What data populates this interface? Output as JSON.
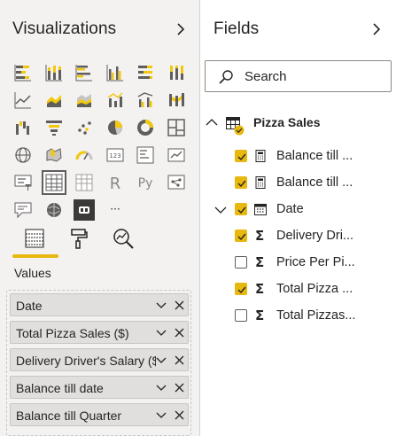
{
  "visualizations": {
    "title": "Visualizations",
    "gallery": [
      [
        "stacked-bar-chart",
        "stacked-column-chart",
        "clustered-bar-chart",
        "clustered-column-chart",
        "100-stacked-bar-chart",
        "100-stacked-column-chart"
      ],
      [
        "line-chart",
        "area-chart",
        "stacked-area-chart",
        "line-and-stacked-column-chart",
        "line-and-clustered-column-chart",
        "ribbon-chart"
      ],
      [
        "waterfall-chart",
        "funnel-chart",
        "scatter-chart",
        "pie-chart",
        "donut-chart",
        "treemap"
      ],
      [
        "map",
        "filled-map",
        "gauge",
        "card",
        "multi-row-card",
        "kpi"
      ],
      [
        "slicer",
        "table",
        "matrix",
        "r-visual",
        "python-visual",
        "key-influencers"
      ],
      [
        "qa-visual",
        "arcgis-map",
        "custom-visual",
        "more-visuals"
      ]
    ],
    "selected": "table",
    "r_letter": "R",
    "py_letters": "Py",
    "more_label": "···",
    "build_tabs": [
      "fields-tab",
      "format-tab",
      "analytics-tab"
    ],
    "active_tab": "fields-tab",
    "values_label": "Values",
    "wells": [
      {
        "label": "Date"
      },
      {
        "label": "Total Pizza Sales ($)"
      },
      {
        "label": "Delivery Driver's Salary ($)"
      },
      {
        "label": "Balance till date"
      },
      {
        "label": "Balance till Quarter"
      }
    ]
  },
  "fields": {
    "title": "Fields",
    "search_placeholder": "Search",
    "table_name": "Pizza Sales",
    "items": [
      {
        "label": "Balance till ...",
        "checked": true,
        "icon": "calculator-icon"
      },
      {
        "label": "Balance till ...",
        "checked": true,
        "icon": "calculator-icon"
      },
      {
        "label": "Date",
        "checked": true,
        "icon": "calendar-icon",
        "expandable": true
      },
      {
        "label": "Delivery Dri...",
        "checked": true,
        "icon": "sigma-icon"
      },
      {
        "label": "Price Per Pi...",
        "checked": false,
        "icon": "sigma-icon"
      },
      {
        "label": "Total Pizza ...",
        "checked": true,
        "icon": "sigma-icon"
      },
      {
        "label": "Total Pizzas...",
        "checked": false,
        "icon": "sigma-icon"
      }
    ],
    "sigma_glyph": "Σ"
  },
  "colors": {
    "accent": "#e8b80e",
    "pane_bg": "#f3f2f1",
    "chart_yellow": "#f2c80f",
    "chart_grey": "#605e5c"
  }
}
